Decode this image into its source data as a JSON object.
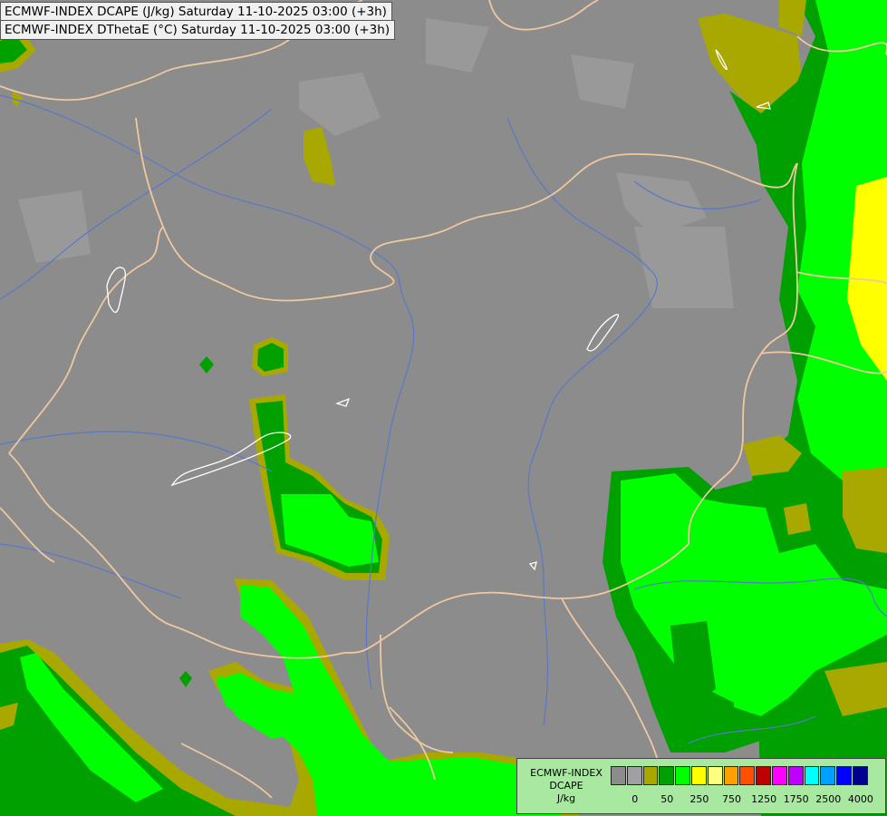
{
  "titles": {
    "line1": "ECMWF-INDEX DCAPE (J/kg) Saturday 11-10-2025 03:00 (+3h)",
    "line2": "ECMWF-INDEX DThetaE (°C) Saturday 11-10-2025 03:00 (+3h)"
  },
  "legend": {
    "line1": "ECMWF-INDEX",
    "line2": "DCAPE",
    "line3": "J/kg",
    "ticks": [
      "0",
      "50",
      "250",
      "750",
      "1250",
      "1750",
      "2500",
      "4000"
    ],
    "colors": [
      "#8c8c8c",
      "#a0a0a0",
      "#a8a800",
      "#00a000",
      "#00ff00",
      "#ffff00",
      "#ffff80",
      "#ffa000",
      "#ff5000",
      "#c00000",
      "#ff00ff",
      "#c000ff",
      "#00ffff",
      "#00a0ff",
      "#0000ff",
      "#000090"
    ]
  },
  "map_colors": {
    "background": "#8c8c8c",
    "level_olive": "#a8a800",
    "level_darkgreen": "#00a000",
    "level_green": "#00ff00",
    "level_yellow": "#ffff00",
    "borders": "#f0c8a0",
    "rivers": "#5a78c8",
    "lakes": "#ffffff"
  }
}
